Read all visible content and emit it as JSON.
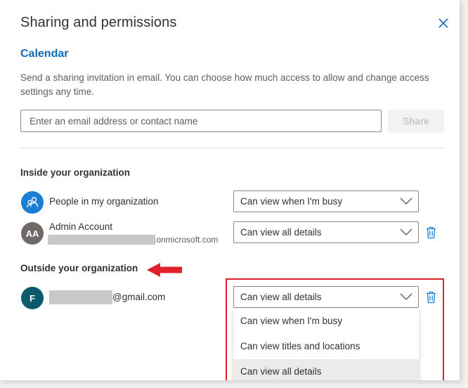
{
  "dialog": {
    "title": "Sharing and permissions",
    "calendar_name": "Calendar",
    "description": "Send a sharing invitation in email. You can choose how much access to allow and change access settings any time.",
    "email_placeholder": "Enter an email address or contact name",
    "share_label": "Share"
  },
  "inside": {
    "heading": "Inside your organization",
    "people": [
      {
        "name": "People in my organization",
        "permission": "Can view when I'm busy"
      },
      {
        "initials": "AA",
        "name": "Admin Account",
        "email_suffix": ".onmicrosoft.com",
        "permission": "Can view all details"
      }
    ]
  },
  "outside": {
    "heading": "Outside your organization",
    "people": [
      {
        "initials": "F",
        "email_suffix": "@gmail.com",
        "permission": "Can view all details"
      }
    ]
  },
  "dropdown_options": [
    "Can view when I'm busy",
    "Can view titles and locations",
    "Can view all details"
  ],
  "colors": {
    "accent": "#0f6cbd",
    "org_avatar": "#1a7fd4",
    "admin_avatar": "#6f6a67",
    "guest_avatar": "#0b5a6b",
    "annotation": "#e0202a"
  },
  "icons": {
    "close": "close-icon",
    "org": "people-icon",
    "chevron": "chevron-down-icon",
    "delete": "trash-icon",
    "annotation_arrow": "arrow-left-icon"
  }
}
